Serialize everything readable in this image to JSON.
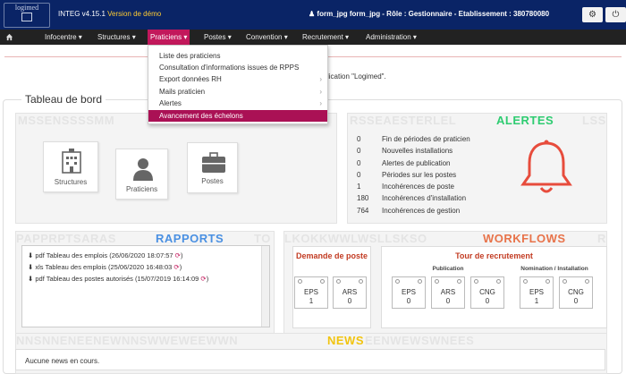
{
  "header": {
    "logo_text": "logimed",
    "app_name": "INTEG v4.15.1",
    "demo_label": "Version de démo",
    "user_info": "form_jpg form_jpg - Rôle : Gestionnaire - Etablissement : 380780080",
    "settings_icon": "gear-icon",
    "power_icon": "power-icon"
  },
  "nav": {
    "home_icon": "home-icon",
    "items": [
      {
        "label": "Infocentre"
      },
      {
        "label": "Structures"
      },
      {
        "label": "Praticiens"
      },
      {
        "label": "Postes"
      },
      {
        "label": "Convention"
      },
      {
        "label": "Recrutement"
      },
      {
        "label": "Administration"
      }
    ],
    "active": "Praticiens"
  },
  "dropdown": {
    "items": [
      {
        "label": "Liste des praticiens",
        "submenu": false
      },
      {
        "label": "Consultation d'informations issues de RPPS",
        "submenu": false
      },
      {
        "label": "Export données RH",
        "submenu": true
      },
      {
        "label": "Mails praticien",
        "submenu": true
      },
      {
        "label": "Alertes",
        "submenu": true
      },
      {
        "label": "Avancement des échelons",
        "submenu": false
      }
    ],
    "highlighted": "Avancement des échelons"
  },
  "welcome_fragment": "ur l'application \"Logimed\".",
  "dashboard": {
    "title": "Tableau de bord",
    "modules_bg": "MSSENSSSSMM",
    "tiles": [
      {
        "label": "Structures",
        "icon": "building-icon"
      },
      {
        "label": "Praticiens",
        "icon": "user-icon"
      },
      {
        "label": "Postes",
        "icon": "briefcase-icon"
      }
    ],
    "alertes": {
      "bg": "RSSEAESTERLEL",
      "title": "ALERTES",
      "bg_suffix": "LSS",
      "bell_icon": "bell-icon",
      "rows": [
        {
          "count": "0",
          "label": "Fin de périodes de praticien"
        },
        {
          "count": "0",
          "label": "Nouvelles installations"
        },
        {
          "count": "0",
          "label": "Alertes de publication"
        },
        {
          "count": "0",
          "label": "Périodes sur les postes"
        },
        {
          "count": "1",
          "label": "Incohérences de poste"
        },
        {
          "count": "180",
          "label": "Incohérences d'installation"
        },
        {
          "count": "764",
          "label": "Incohérences de gestion"
        }
      ]
    },
    "rapports": {
      "bg": "PAPPRPTSARAS",
      "title": "RAPPORTS",
      "bg_suffix": "TO",
      "rows": [
        {
          "type": "pdf",
          "text": "Tableau des emplois (26/06/2020 18:07:57"
        },
        {
          "type": "xls",
          "text": "Tableau des emplois (25/06/2020 16:48:03"
        },
        {
          "type": "pdf",
          "text": "Tableau des postes autorisés (15/07/2019 16:14:09"
        }
      ]
    },
    "workflows": {
      "bg": "LKOKKWWLWSLLSKSO",
      "title": "WORKFLOWS",
      "bg_suffix": "R",
      "demande_title": "Demande de poste",
      "demande_boxes": [
        {
          "label": "EPS",
          "value": "1"
        },
        {
          "label": "ARS",
          "value": "0"
        }
      ],
      "tour_title": "Tour de recrutement",
      "publication_label": "Publication",
      "nomination_label": "Nomination / Installation",
      "publication_boxes": [
        {
          "label": "EPS",
          "value": "0"
        },
        {
          "label": "ARS",
          "value": "0"
        },
        {
          "label": "CNG",
          "value": "0"
        }
      ],
      "nomination_boxes": [
        {
          "label": "EPS",
          "value": "1"
        },
        {
          "label": "CNG",
          "value": "0"
        }
      ]
    },
    "news": {
      "bg": "NNSNNENEENEWNNSWWEWEEWWN",
      "title": "NEWS",
      "bg_suffix": "EENWEWSWNEES",
      "text": "Aucune news en cours."
    }
  },
  "colors": {
    "header_bg": "#0a2466",
    "nav_bg": "#222222",
    "active_nav": "#c2185b",
    "highlight": "#aa1155",
    "alertes": "#2ecc71",
    "rapports": "#4a90e2",
    "workflows": "#e8734a",
    "news": "#f1c40f",
    "bell": "#e74c3c"
  }
}
